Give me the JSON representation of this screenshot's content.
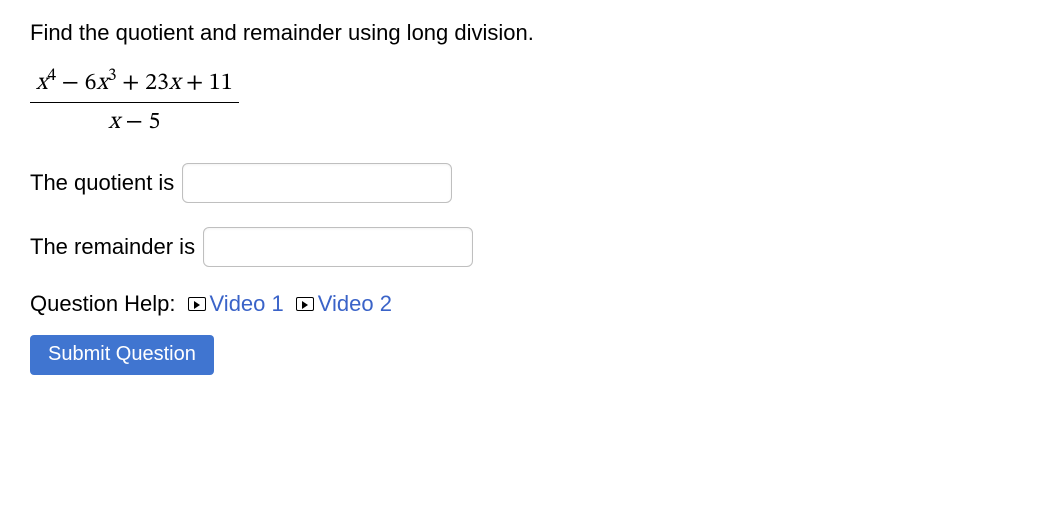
{
  "instruction": "Find the quotient and remainder using long division.",
  "expression": {
    "numerator_html": "<span class='mi'>x</span><sup>4</sup> − 6<span class='mi'>x</span><sup>3</sup> + 23<span class='mi'>x</span> + 11",
    "denominator_html": "<span class='mi'>x</span> − 5"
  },
  "fields": {
    "quotient_label": "The quotient is",
    "quotient_value": "",
    "remainder_label": "The remainder is",
    "remainder_value": ""
  },
  "help": {
    "label": "Question Help:",
    "links": [
      "Video 1",
      "Video 2"
    ]
  },
  "submit_label": "Submit Question"
}
